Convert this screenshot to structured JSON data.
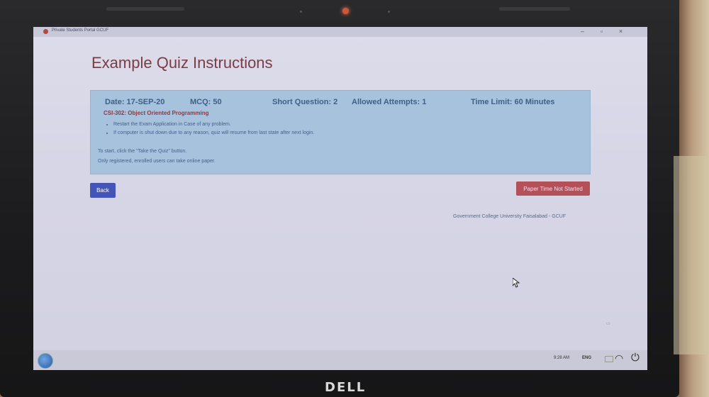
{
  "device": {
    "brand": "DELL"
  },
  "browser": {
    "tab_title": "Private Students Portal GCUF"
  },
  "page": {
    "title": "Example Quiz Instructions"
  },
  "quiz": {
    "date": "Date: 17-SEP-20",
    "mcq": "MCQ: 50",
    "short_question": "Short Question: 2",
    "allowed_attempts": "Allowed Attempts: 1",
    "time_limit": "Time Limit: 60 Minutes",
    "course": "CSI-302: Object Oriented Programming",
    "bullets": [
      "Restart the Exam Application in Case of any problem.",
      "If computer is shut down due to any reason, quiz will resume from last state after next login."
    ],
    "note_1": "To start, click the \"Take the Quiz\" button.",
    "note_2": "Only registered, enrolled users can take online paper."
  },
  "buttons": {
    "back": "Back",
    "status": "Paper Time Not Started"
  },
  "footer": {
    "text": "Government College University Faisalabad - GCUF"
  },
  "taskbar": {
    "time": "9:28 AM",
    "language": "ENG"
  },
  "colors": {
    "title": "#7a3c46",
    "info_bg": "#a7c2dd",
    "back_btn": "#4455b8",
    "status_btn": "#b45058"
  }
}
